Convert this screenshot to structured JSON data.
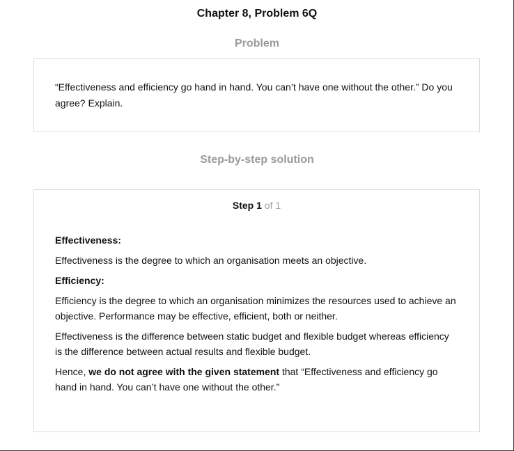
{
  "page": {
    "title": "Chapter 8, Problem 6Q"
  },
  "problem": {
    "heading": "Problem",
    "text": "“Effectiveness and efficiency go hand in hand. You can’t have one without the other.” Do you agree? Explain."
  },
  "solution": {
    "heading": "Step-by-step solution",
    "step": {
      "word": "Step",
      "number": "1",
      "of_text": "of 1"
    },
    "effectiveness_heading": "Effectiveness:",
    "effectiveness_text": "Effectiveness is the degree to which an organisation meets an objective.",
    "efficiency_heading": "Efficiency:",
    "efficiency_text": "Efficiency is the degree to which an organisation minimizes the resources used to achieve an objective. Performance may be effective, efficient, both or neither.",
    "difference_text": "Effectiveness is the difference between static budget and flexible budget whereas efficiency is the difference between actual results and flexible budget.",
    "conclusion": {
      "prefix": "Hence, ",
      "emphasis": "we do not agree with the given statement",
      "suffix": " that “Effectiveness and efficiency go hand in hand. You can’t have one without the other.”"
    }
  }
}
